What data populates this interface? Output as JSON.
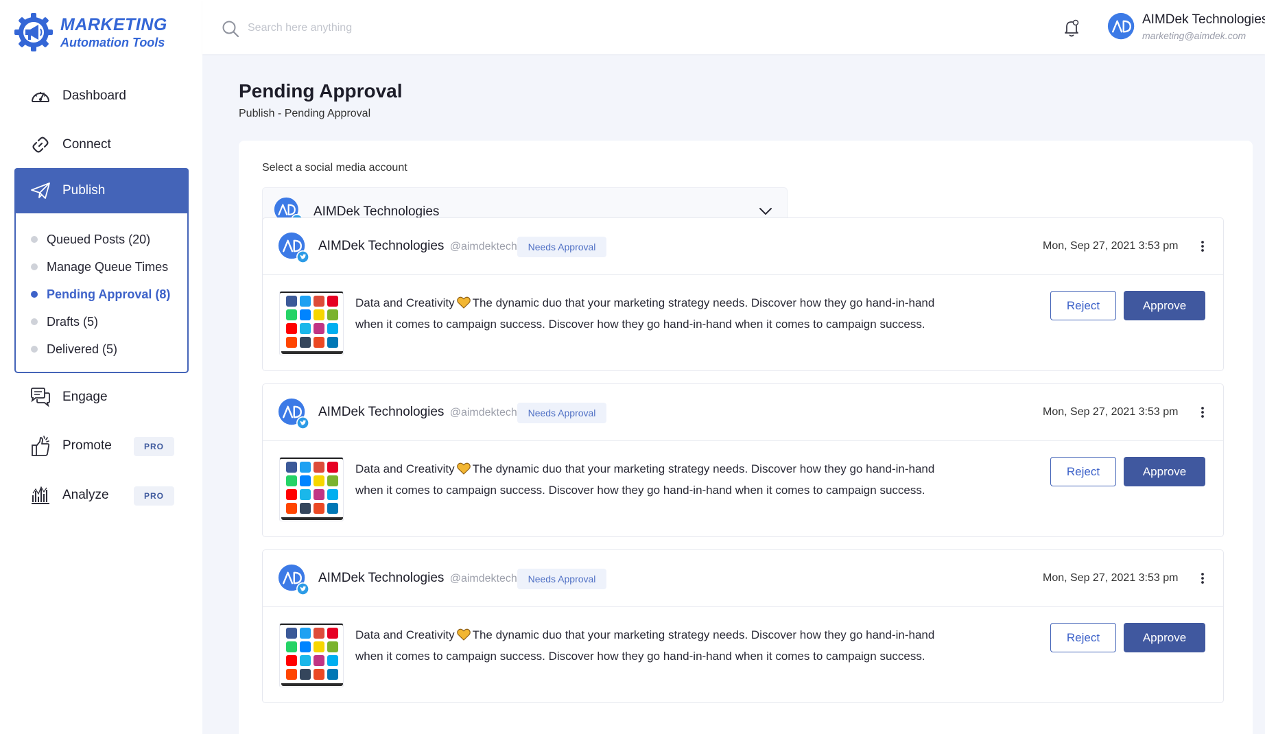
{
  "brand": {
    "line1": "MARKETING",
    "line2": "Automation Tools",
    "color": "#3466d6"
  },
  "search": {
    "placeholder": "Search here anything"
  },
  "user": {
    "name": "AIMDek Technologies",
    "email": "marketing@aimdek.com"
  },
  "nav": {
    "dashboard": "Dashboard",
    "connect": "Connect",
    "publish": "Publish",
    "engage": "Engage",
    "promote": "Promote",
    "analyze": "Analyze",
    "pro_badge": "PRO"
  },
  "publish_sub": [
    {
      "label": "Queued Posts (20)"
    },
    {
      "label": "Manage Queue Times"
    },
    {
      "label": "Pending Approval (8)"
    },
    {
      "label": "Drafts (5)"
    },
    {
      "label": "Delivered (5)"
    }
  ],
  "page": {
    "title": "Pending Approval",
    "breadcrumb": "Publish - Pending Approval"
  },
  "account_select": {
    "label": "Select a social media account",
    "value": "AIMDek Technologies"
  },
  "posts": [
    {
      "name": "AIMDek Technologies",
      "handle": "@aimdektech",
      "status": "Needs Approval",
      "date": "Mon, Sep 27, 2021 3:53 pm",
      "text_before": "Data and Creativity",
      "text_after": "The dynamic duo that your marketing strategy needs. Discover how they go hand-in-hand when it comes to campaign success. Discover how they go hand-in-hand when it comes to campaign success.",
      "reject": "Reject",
      "approve": "Approve"
    },
    {
      "name": "AIMDek Technologies",
      "handle": "@aimdektech",
      "status": "Needs Approval",
      "date": "Mon, Sep 27, 2021 3:53 pm",
      "text_before": "Data and Creativity",
      "text_after": "The dynamic duo that your marketing strategy needs. Discover how they go hand-in-hand when it comes to campaign success. Discover how they go hand-in-hand when it comes to campaign success.",
      "reject": "Reject",
      "approve": "Approve"
    },
    {
      "name": "AIMDek Technologies",
      "handle": "@aimdektech",
      "status": "Needs Approval",
      "date": "Mon, Sep 27, 2021 3:53 pm",
      "text_before": "Data and Creativity",
      "text_after": "The dynamic duo that your marketing strategy needs. Discover how they go hand-in-hand when it comes to campaign success. Discover how they go hand-in-hand when it comes to campaign success.",
      "reject": "Reject",
      "approve": "Approve"
    }
  ],
  "colors": {
    "accent": "#4464b8",
    "approve": "#40589f",
    "badge_bg": "#eef2fb",
    "page_bg": "#f3f5fb"
  },
  "thumbnail_icons": [
    "facebook-icon",
    "twitter-icon",
    "google-plus-icon",
    "pinterest-icon",
    "whatsapp-icon",
    "messenger-icon",
    "snapchat-icon",
    "wechat-icon",
    "youtube-icon",
    "vimeo-icon",
    "instagram-icon",
    "skype-icon",
    "reddit-icon",
    "tumblr-icon",
    "stumbleupon-icon",
    "linkedin-icon"
  ]
}
